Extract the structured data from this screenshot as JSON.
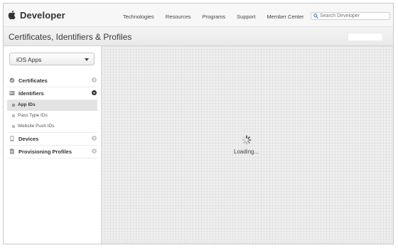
{
  "header": {
    "brand": "Developer",
    "nav": [
      "Technologies",
      "Resources",
      "Programs",
      "Support",
      "Member Center"
    ],
    "search_placeholder": "Search Developer"
  },
  "titlebar": {
    "title": "Certificates, Identifiers & Profiles"
  },
  "sidebar": {
    "platform_select": "iOS Apps",
    "items": [
      {
        "label": "Certificates",
        "icon": "certificate-icon",
        "expanded": false
      },
      {
        "label": "Identifiers",
        "icon": "id-card-icon",
        "expanded": true,
        "children": [
          "App IDs",
          "Pass Type IDs",
          "Website Push IDs"
        ],
        "active_child": "App IDs"
      },
      {
        "label": "Devices",
        "icon": "device-icon",
        "expanded": false
      },
      {
        "label": "Provisioning Profiles",
        "icon": "document-icon",
        "expanded": false
      }
    ]
  },
  "main": {
    "status_text": "Loading..."
  }
}
